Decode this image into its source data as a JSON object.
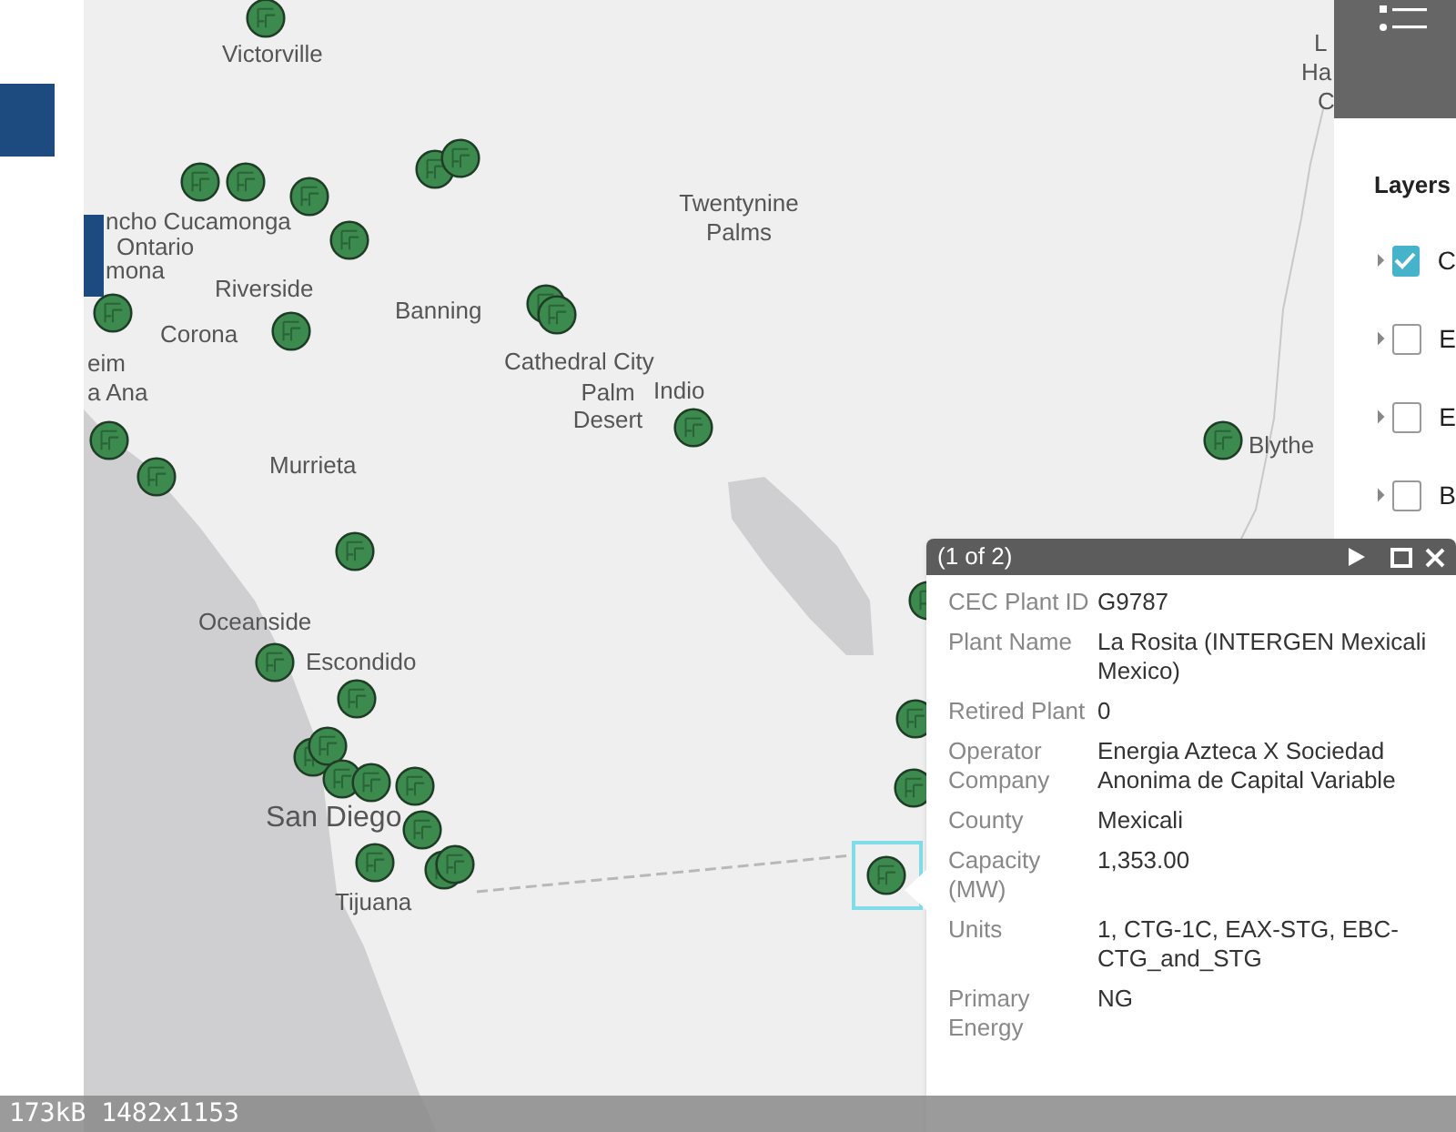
{
  "map": {
    "labels": [
      "Victorville",
      "L",
      "Ha",
      "C",
      "ncho Cucamonga",
      "Ontario",
      "Twentynine Palms",
      "mona",
      "Riverside",
      "Corona",
      "Banning",
      "eim",
      "Cathedral City",
      "a Ana",
      "Palm Desert",
      "Indio",
      "Blythe",
      "Murrieta",
      "Oceanside",
      "Escondido",
      "San Diego",
      "Tijuana"
    ]
  },
  "layers_panel": {
    "title": "Layers",
    "items": [
      {
        "label": "C",
        "checked": true
      },
      {
        "label": "E",
        "checked": false
      },
      {
        "label": "E",
        "checked": false
      },
      {
        "label": "B",
        "checked": false
      }
    ]
  },
  "popup": {
    "counter": "(1 of 2)",
    "fields": [
      {
        "label": "CEC Plant ID",
        "value": "G9787"
      },
      {
        "label": "Plant Name",
        "value": "La Rosita (INTERGEN Mexicali Mexico)"
      },
      {
        "label": "Retired Plant",
        "value": "0"
      },
      {
        "label": "Operator Company",
        "value": "Energia Azteca X Sociedad Anonima de Capital Variable"
      },
      {
        "label": "County",
        "value": "Mexicali"
      },
      {
        "label": "Capacity (MW)",
        "value": "1,353.00"
      },
      {
        "label": "Units",
        "value": "1, CTG-1C, EAX-STG, EBC-CTG_and_STG"
      },
      {
        "label": "Primary Energy",
        "value": "NG"
      }
    ]
  },
  "image_info": "173kB 1482x1153"
}
